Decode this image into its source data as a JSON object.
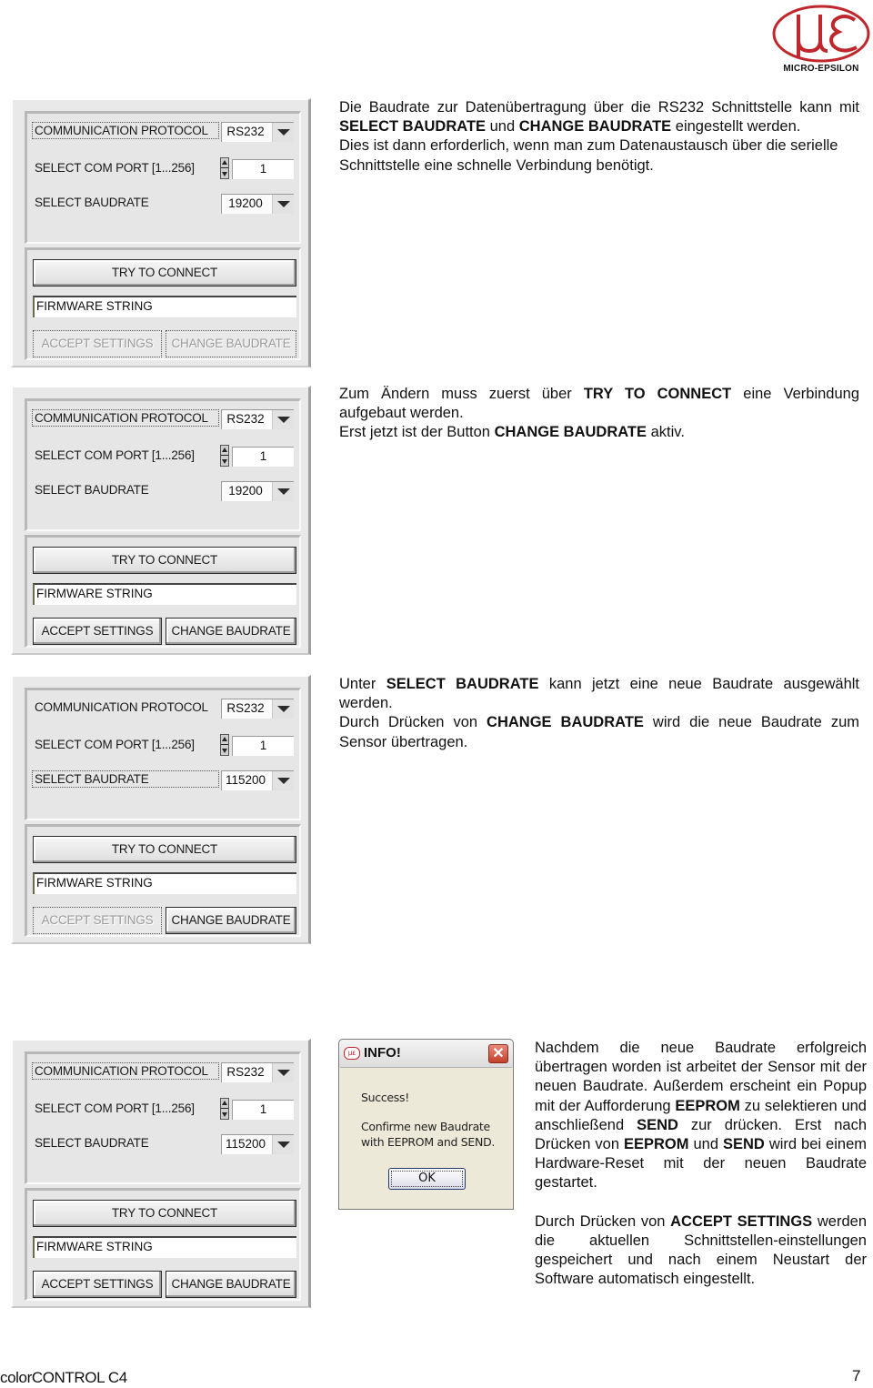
{
  "header": {
    "logo_text": "MICRO-EPSILON",
    "logo_glyph": "µε",
    "brand_color": "#c0272d"
  },
  "panels": [
    {
      "communication_protocol_label": "COMMUNICATION PROTOCOL",
      "communication_protocol_value": "RS232",
      "com_port_label": "SELECT COM PORT [1...256]",
      "com_port_value": "1",
      "baudrate_label": "SELECT BAUDRATE",
      "baudrate_value": "19200",
      "try_connect_label": "TRY TO CONNECT",
      "firmware_string": "FIRMWARE STRING",
      "accept_settings_label": "ACCEPT SETTINGS",
      "change_baudrate_label": "CHANGE BAUDRATE",
      "accept_enabled": false,
      "change_enabled": false,
      "focused_field": "communication_protocol"
    },
    {
      "communication_protocol_label": "COMMUNICATION PROTOCOL",
      "communication_protocol_value": "RS232",
      "com_port_label": "SELECT COM PORT [1...256]",
      "com_port_value": "1",
      "baudrate_label": "SELECT BAUDRATE",
      "baudrate_value": "19200",
      "try_connect_label": "TRY TO CONNECT",
      "firmware_string": "FIRMWARE STRING",
      "accept_settings_label": "ACCEPT SETTINGS",
      "change_baudrate_label": "CHANGE BAUDRATE",
      "accept_enabled": true,
      "change_enabled": true,
      "focused_field": "communication_protocol"
    },
    {
      "communication_protocol_label": "COMMUNICATION PROTOCOL",
      "communication_protocol_value": "RS232",
      "com_port_label": "SELECT COM PORT [1...256]",
      "com_port_value": "1",
      "baudrate_label": "SELECT BAUDRATE",
      "baudrate_value": "115200",
      "try_connect_label": "TRY TO CONNECT",
      "firmware_string": "FIRMWARE STRING",
      "accept_settings_label": "ACCEPT SETTINGS",
      "change_baudrate_label": "CHANGE BAUDRATE",
      "accept_enabled": false,
      "change_enabled": true,
      "focused_field": "baudrate"
    },
    {
      "communication_protocol_label": "COMMUNICATION PROTOCOL",
      "communication_protocol_value": "RS232",
      "com_port_label": "SELECT COM PORT [1...256]",
      "com_port_value": "1",
      "baudrate_label": "SELECT BAUDRATE",
      "baudrate_value": "115200",
      "try_connect_label": "TRY TO CONNECT",
      "firmware_string": "FIRMWARE STRING",
      "accept_settings_label": "ACCEPT SETTINGS",
      "change_baudrate_label": "CHANGE BAUDRATE",
      "accept_enabled": true,
      "change_enabled": true,
      "focused_field": "communication_protocol"
    }
  ],
  "descriptions": {
    "section1": {
      "p1_a": "Die Baudrate zur Datenübertragung über die RS232 Schnittstelle kann mit ",
      "p1_b1": "SELECT BAUDRATE",
      "p1_c": " und ",
      "p1_b2": "CHANGE BAUDRATE",
      "p1_d": " eingestellt werden.",
      "p2": "Dies ist dann erforderlich, wenn man zum Datenaustausch über die serielle Schnittstelle eine schnelle Verbindung benötigt."
    },
    "section2": {
      "p1_a": "Zum Ändern muss zuerst über ",
      "p1_b": "TRY TO CONNECT",
      "p1_c": " eine Verbindung aufgebaut werden.",
      "p2_a": "Erst jetzt ist der Button ",
      "p2_b": "CHANGE BAUDRATE",
      "p2_c": " aktiv."
    },
    "section3": {
      "p1_a": "Unter ",
      "p1_b": "SELECT BAUDRATE",
      "p1_c": " kann jetzt eine neue Baudrate ausgewählt werden.",
      "p2_a": "Durch Drücken von ",
      "p2_b": "CHANGE BAUDRATE",
      "p2_c": " wird die neue Baudrate zum Sensor übertragen."
    },
    "section4": {
      "p1_a": "Nachdem die neue Baudrate erfolgreich übertragen worden ist arbeitet der Sensor mit der neuen Baudrate. Außerdem erscheint ein Popup mit der Aufforderung ",
      "p1_b1": "EEPROM",
      "p1_c": " zu selektieren und anschließend ",
      "p1_b2": "SEND",
      "p1_d": " zur drücken. Erst nach Drücken von ",
      "p1_b3": "EEPROM",
      "p1_e": " und ",
      "p1_b4": "SEND",
      "p1_f": " wird bei einem Hardware-Reset mit der neuen Baudrate gestartet.",
      "p2_a": "Durch Drücken von ",
      "p2_b": "ACCEPT SETTINGS",
      "p2_c": " werden die aktuellen Schnittstellen-einstellungen gespeichert und nach einem Neustart der Software automatisch eingestellt."
    }
  },
  "popup": {
    "title": "INFO!",
    "icon": "µε",
    "close_glyph": "✕",
    "line1": "Success!",
    "line2": "Confirme new Baudrate",
    "line3": "with EEPROM and SEND.",
    "ok_label": "OK"
  },
  "footer": {
    "product": "colorCONTROL C4",
    "page_number": "7"
  }
}
